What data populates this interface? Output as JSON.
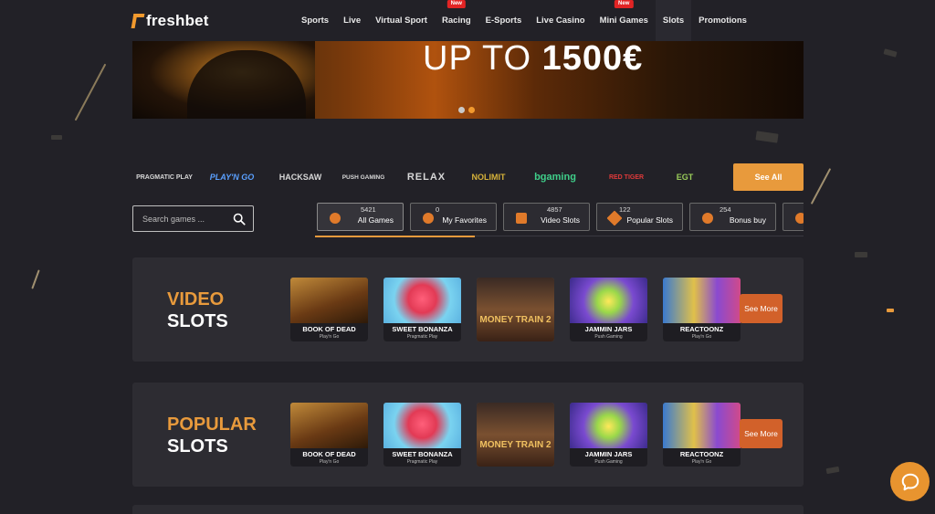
{
  "brand": {
    "name": "freshbet"
  },
  "nav": [
    {
      "label": "Sports",
      "new": false
    },
    {
      "label": "Live",
      "new": false
    },
    {
      "label": "Virtual Sport",
      "new": false
    },
    {
      "label": "Racing",
      "new": true
    },
    {
      "label": "E-Sports",
      "new": false
    },
    {
      "label": "Live Casino",
      "new": false
    },
    {
      "label": "Mini Games",
      "new": true
    },
    {
      "label": "Slots",
      "new": false,
      "active": true
    },
    {
      "label": "Promotions",
      "new": false
    }
  ],
  "new_badge": "New",
  "banner": {
    "text_light": "UP TO ",
    "text_bold": "1500€",
    "slides": 2,
    "active_slide": 2
  },
  "providers": [
    "PRAGMATIC PLAY",
    "PLAY'N GO",
    "HACKSAW",
    "PUSH GAMING",
    "RELAX",
    "NOLIMIT",
    "bgaming",
    "RED TIGER",
    "EGT"
  ],
  "see_all_label": "See All",
  "search": {
    "placeholder": "Search games ..."
  },
  "categories": [
    {
      "label": "All Games",
      "count": "5421",
      "active": true
    },
    {
      "label": "My Favorites",
      "count": "0",
      "active": false
    },
    {
      "label": "Video Slots",
      "count": "4857",
      "active": false
    },
    {
      "label": "Popular Slots",
      "count": "122",
      "active": false
    },
    {
      "label": "Bonus buy",
      "count": "254",
      "active": false
    },
    {
      "label": "",
      "count": "",
      "active": false
    }
  ],
  "sections": [
    {
      "title_line1": "VIDEO",
      "title_line2": "SLOTS",
      "see_more": "See More",
      "games": [
        {
          "name": "BOOK OF DEAD",
          "provider": "Play'n Go",
          "color": "#7a4a1e"
        },
        {
          "name": "SWEET BONANZA",
          "provider": "Pragmatic Play",
          "color": "#c8455e"
        },
        {
          "name": "MONEY TRAIN 2",
          "provider": "",
          "color": "#6b4a2c"
        },
        {
          "name": "JAMMIN JARS",
          "provider": "Push Gaming",
          "color": "#4a3a8a"
        },
        {
          "name": "REACTOONZ",
          "provider": "Play'n Go",
          "color": "#3a6aa8"
        }
      ]
    },
    {
      "title_line1": "POPULAR",
      "title_line2": "SLOTS",
      "see_more": "See More",
      "games": [
        {
          "name": "BOOK OF DEAD",
          "provider": "Play'n Go",
          "color": "#7a4a1e"
        },
        {
          "name": "SWEET BONANZA",
          "provider": "Pragmatic Play",
          "color": "#c8455e"
        },
        {
          "name": "MONEY TRAIN 2",
          "provider": "",
          "color": "#6b4a2c"
        },
        {
          "name": "JAMMIN JARS",
          "provider": "Push Gaming",
          "color": "#4a3a8a"
        },
        {
          "name": "REACTOONZ",
          "provider": "Play'n Go",
          "color": "#3a6aa8"
        }
      ]
    }
  ],
  "colors": {
    "accent": "#e89a3c",
    "see_more": "#d2612a",
    "badge": "#e22424"
  }
}
